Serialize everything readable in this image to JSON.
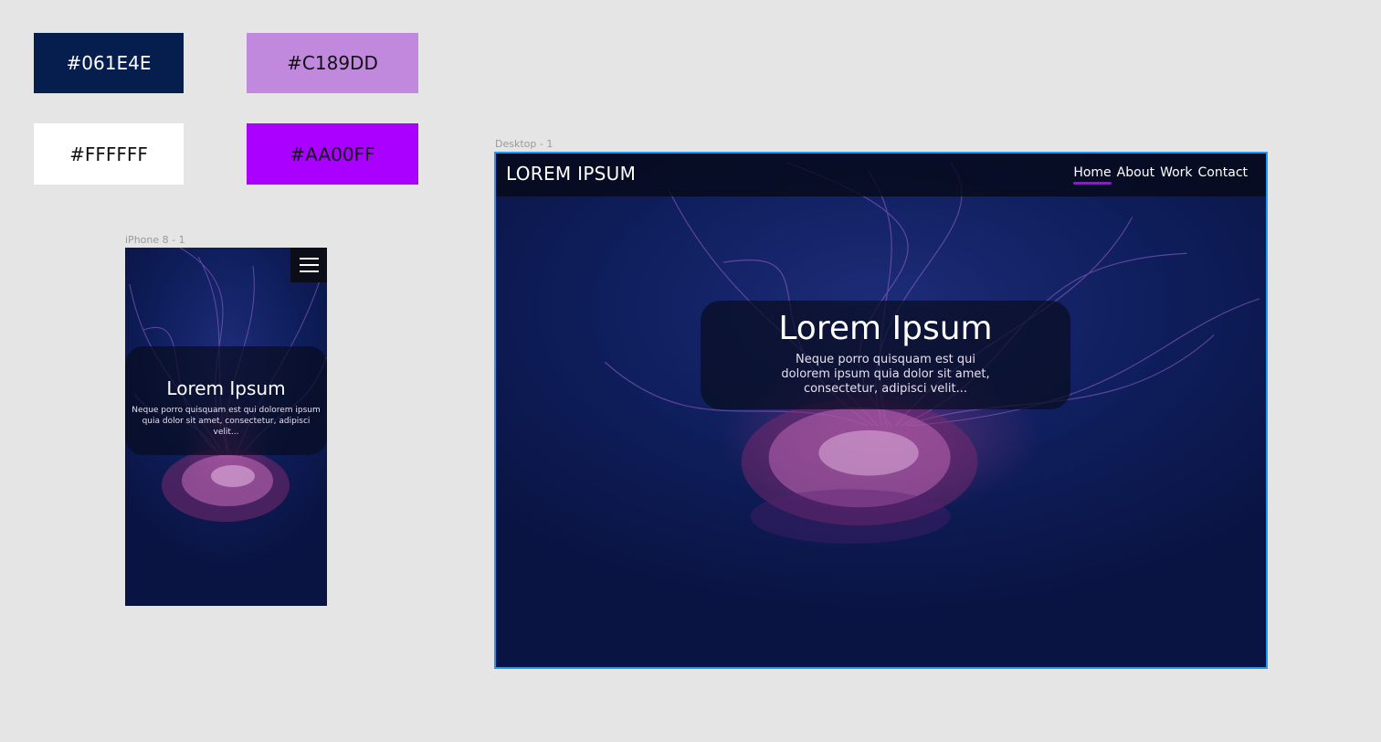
{
  "palette": {
    "swatches": [
      {
        "hex": "#061E4E",
        "color": "#061E4E",
        "text_color": "#ffffff"
      },
      {
        "hex": "#C189DD",
        "color": "#C189DD",
        "text_color": "#111111"
      },
      {
        "hex": "#FFFFFF",
        "color": "#FFFFFF",
        "text_color": "#111111"
      },
      {
        "hex": "#AA00FF",
        "color": "#AA00FF",
        "text_color": "#111111"
      }
    ]
  },
  "artboards": {
    "mobile": {
      "label": "iPhone 8 - 1"
    },
    "desktop": {
      "label": "Desktop - 1"
    }
  },
  "site": {
    "brand": "LOREM IPSUM",
    "nav": [
      "Home",
      "About",
      "Work",
      "Contact"
    ],
    "active_nav": "Home",
    "hero_title": "Lorem Ipsum",
    "hero_text_desktop": "Neque porro quisquam est qui dolorem ipsum quia dolor sit amet, consectetur, adipisci velit...",
    "hero_text_mobile": "Neque porro quisquam est qui dolorem ipsum quia dolor sit amet, consectetur, adipisci velit...",
    "menu_icon": "hamburger-menu-icon"
  },
  "colors": {
    "accent": "#AA00FF",
    "selection_border": "#2196f3"
  }
}
